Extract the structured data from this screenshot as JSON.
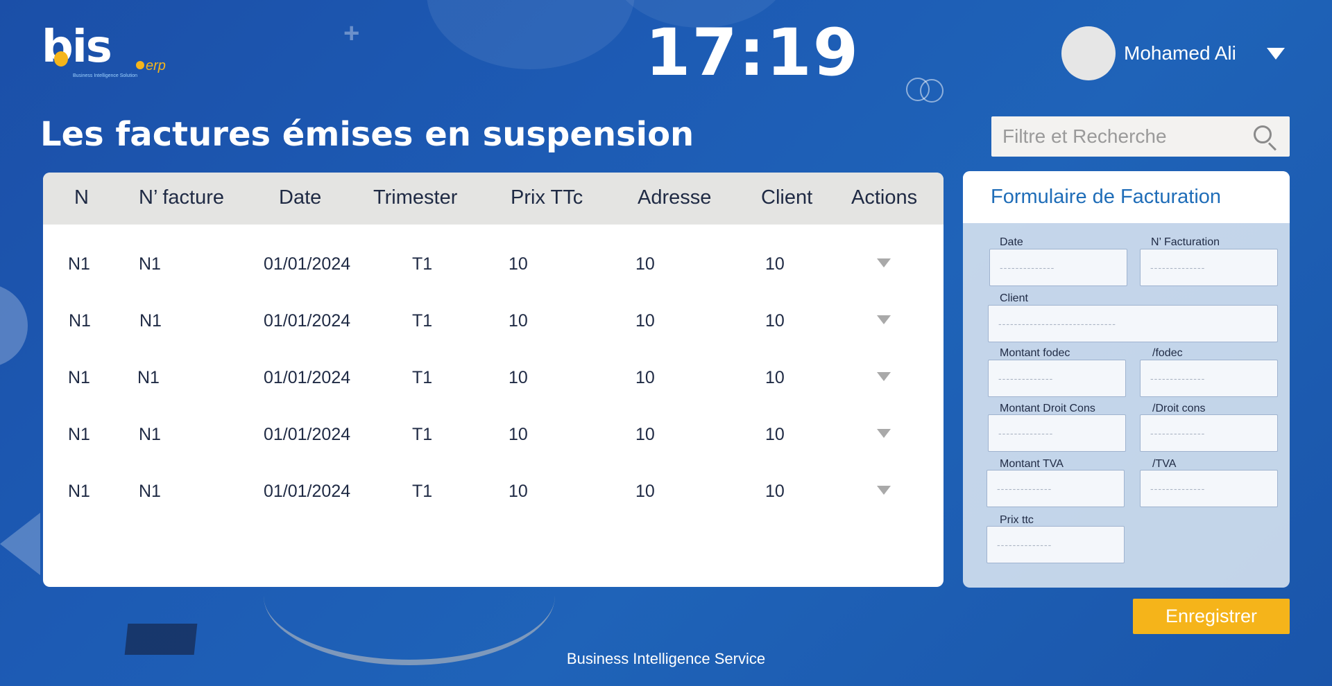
{
  "header": {
    "logo_text": "bis",
    "logo_suffix": "erp",
    "logo_tagline": "Business Intelligence Solution",
    "clock": "17:19",
    "user_name": "Mohamed Ali"
  },
  "page_title": "Les factures émises en suspension",
  "search": {
    "placeholder": "Filtre et Recherche"
  },
  "table": {
    "columns": [
      "N",
      "N’ facture",
      "Date",
      "Trimester",
      "Prix TTc",
      "Adresse",
      "Client",
      "Actions"
    ],
    "rows": [
      [
        "N1",
        "N1",
        "01/01/2024",
        "T1",
        "10",
        "10",
        "10"
      ],
      [
        "N1",
        "N1",
        "01/01/2024",
        "T1",
        "10",
        "10",
        "10"
      ],
      [
        "N1",
        "N1",
        "01/01/2024",
        "T1",
        "10",
        "10",
        "10"
      ],
      [
        "N1",
        "N1",
        "01/01/2024",
        "T1",
        "10",
        "10",
        "10"
      ],
      [
        "N1",
        "N1",
        "01/01/2024",
        "T1",
        "10",
        "10",
        "10"
      ]
    ]
  },
  "form": {
    "title": "Formulaire de Facturation",
    "fields": {
      "date": {
        "label": "Date",
        "placeholder": "--------------"
      },
      "n_facturation": {
        "label": "N’ Facturation",
        "placeholder": "--------------"
      },
      "client": {
        "label": "Client",
        "placeholder": "------------------------------"
      },
      "montant_fodec": {
        "label": "Montant fodec",
        "placeholder": "--------------"
      },
      "pct_fodec": {
        "label": "/fodec",
        "placeholder": "--------------"
      },
      "montant_droit_cons": {
        "label": "Montant Droit Cons",
        "placeholder": "--------------"
      },
      "pct_droit_cons": {
        "label": "/Droit cons",
        "placeholder": "--------------"
      },
      "montant_tva": {
        "label": "Montant TVA",
        "placeholder": "--------------"
      },
      "pct_tva": {
        "label": "/TVA",
        "placeholder": "--------------"
      },
      "prix_ttc": {
        "label": "Prix ttc",
        "placeholder": "--------------"
      }
    },
    "save_label": "Enregistrer"
  },
  "footer": {
    "text": "Business Intelligence Service"
  },
  "colors": {
    "accent": "#f5b41a",
    "brand_blue": "#1f6db8",
    "background": "#1d5bb4"
  }
}
